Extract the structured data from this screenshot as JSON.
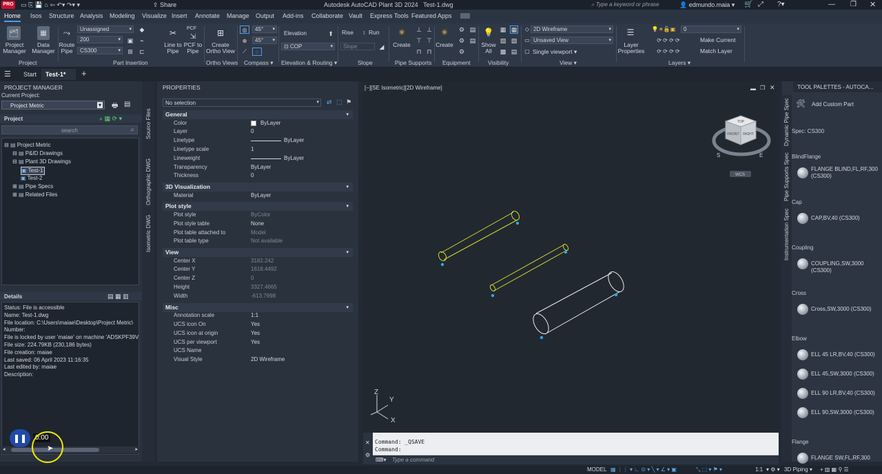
{
  "titlebar": {
    "app_badge": "PRO",
    "share": "Share",
    "title": "Autodesk AutoCAD Plant 3D 2024",
    "filename": "Test-1.dwg",
    "search_placeholder": "Type a keyword or phrase",
    "user": "edmundo.maia"
  },
  "menu": [
    "Home",
    "Isos",
    "Structure",
    "Analysis",
    "Modeling",
    "Visualize",
    "Insert",
    "Annotate",
    "Manage",
    "Output",
    "Add-ins",
    "Collaborate",
    "Vault",
    "Express Tools",
    "Featured Apps"
  ],
  "ribbon": {
    "project_manager": "Project\nManager",
    "data_manager": "Data\nManager",
    "route_pipe": "Route\nPipe",
    "unassigned": "Unassigned",
    "size": "200",
    "spec": "CS300",
    "line_to_pipe": "Line to\nPipe",
    "pcf_to_pipe": "PCF to\nPipe",
    "pcf": "PCF",
    "create_ortho": "Create\nOrtho View",
    "angle1": "45°",
    "angle2": "45°",
    "elevation": "Elevation",
    "cop": "COP",
    "rise": "Rise",
    "run": "Run",
    "slope": "Slope",
    "create_supports": "Create",
    "create_equipment": "Create",
    "show_all": "Show\nAll",
    "visual_style": "2D Wireframe",
    "saved_view": "Unsaved View",
    "viewport": "Single viewport",
    "layer_properties": "Layer\nProperties",
    "layer_value": "0",
    "make_current": "Make Current",
    "match_layer": "Match Layer",
    "groups": {
      "project": "Project",
      "part_insertion": "Part Insertion",
      "ortho_views": "Ortho Views",
      "compass": "Compass",
      "elevation_routing": "Elevation & Routing",
      "slope": "Slope",
      "pipe_supports": "Pipe Supports",
      "equipment": "Equipment",
      "visibility": "Visibility",
      "view": "View",
      "layers": "Layers"
    }
  },
  "doctabs": {
    "start": "Start",
    "active": "Test-1*"
  },
  "project_manager": {
    "title": "PROJECT MANAGER",
    "current_project_label": "Current Project:",
    "current_project": "Project Metric",
    "project_label": "Project",
    "search_placeholder": "search",
    "tree": [
      {
        "label": "Project Metric",
        "level": 0
      },
      {
        "label": "P&ID Drawings",
        "level": 1
      },
      {
        "label": "Plant 3D Drawings",
        "level": 1
      },
      {
        "label": "Test-1",
        "level": 2
      },
      {
        "label": "Test-2",
        "level": 2
      },
      {
        "label": "Pipe Specs",
        "level": 1
      },
      {
        "label": "Related Files",
        "level": 1
      }
    ],
    "details_title": "Details",
    "details": [
      "Status: File is accessible",
      "Name: Test-1.dwg",
      "File location: C:\\Users\\maiae\\Desktop\\Project Metric\\",
      "Number:",
      "File is locked by user 'maiae' on machine 'ADSKPF39V",
      "File size: 224.79KB (230,186 bytes)",
      "File creation: maiae",
      "Last saved: 06 April 2023 11:16:35",
      "Last edited by: maiae",
      "Description:"
    ],
    "side_tabs": [
      "Source Files",
      "Orthographic DWG",
      "Isometric DWG"
    ],
    "timer": "0:00"
  },
  "properties": {
    "title": "PROPERTIES",
    "selection": "No selection",
    "sections": [
      {
        "name": "General",
        "rows": [
          {
            "k": "Color",
            "v": "ByLayer"
          },
          {
            "k": "Layer",
            "v": "0"
          },
          {
            "k": "Linetype",
            "v": "ByLayer"
          },
          {
            "k": "Linetype scale",
            "v": "1"
          },
          {
            "k": "Lineweight",
            "v": "ByLayer"
          },
          {
            "k": "Transparency",
            "v": "ByLayer"
          },
          {
            "k": "Thickness",
            "v": "0"
          }
        ]
      },
      {
        "name": "3D Visualization",
        "rows": [
          {
            "k": "Material",
            "v": "ByLayer"
          }
        ]
      },
      {
        "name": "Plot style",
        "rows": [
          {
            "k": "Plot style",
            "v": "ByColor"
          },
          {
            "k": "Plot style table",
            "v": "None"
          },
          {
            "k": "Plot table attached to",
            "v": "Model"
          },
          {
            "k": "Plot table type",
            "v": "Not available"
          }
        ]
      },
      {
        "name": "View",
        "rows": [
          {
            "k": "Center X",
            "v": "3182.242"
          },
          {
            "k": "Center Y",
            "v": "1618.4492"
          },
          {
            "k": "Center Z",
            "v": "0"
          },
          {
            "k": "Height",
            "v": "3327.4665"
          },
          {
            "k": "Width",
            "v": "-613.7998"
          }
        ]
      },
      {
        "name": "Misc",
        "rows": [
          {
            "k": "Annotation scale",
            "v": "1:1"
          },
          {
            "k": "UCS icon On",
            "v": "Yes"
          },
          {
            "k": "UCS icon at origin",
            "v": "Yes"
          },
          {
            "k": "UCS per viewport",
            "v": "Yes"
          },
          {
            "k": "UCS Name",
            "v": ""
          },
          {
            "k": "Visual Style",
            "v": "2D Wireframe"
          }
        ]
      }
    ]
  },
  "viewport": {
    "label": "[−][SE Isometric][2D Wireframe]",
    "viewcube": {
      "top": "TOP",
      "front": "FRONT",
      "right": "RIGHT",
      "s": "S",
      "e": "E",
      "ucs": "WCS"
    },
    "axes": {
      "z": "Z",
      "y": "Y",
      "x": "X"
    }
  },
  "command": {
    "line1": "Command: _QSAVE",
    "line2": "Command:",
    "placeholder": "Type a command"
  },
  "tool_palettes": {
    "title": "TOOL PALETTES - AUTOCA...",
    "add_custom": "Add Custom Part",
    "spec": "Spec: CS300",
    "side_tabs": [
      "Dynamic Pipe Spec",
      "Pipe Supports Spec",
      "Instrumentation Spec"
    ],
    "categories": [
      {
        "name": "BlindFlange",
        "items": [
          "FLANGE BLIND,FL,RF,300 (CS300)"
        ]
      },
      {
        "name": "Cap",
        "items": [
          "CAP,BV,40 (CS300)"
        ]
      },
      {
        "name": "Coupling",
        "items": [
          "COUPLING,SW,3000 (CS300)"
        ]
      },
      {
        "name": "Cross",
        "items": [
          "Cross,SW,3000 (CS300)"
        ]
      },
      {
        "name": "Elbow",
        "items": [
          "ELL 45 LR,BV,40 (CS300)",
          "ELL 45,SW,3000 (CS300)",
          "ELL 90 LR,BV,40 (CS300)",
          "ELL 90,SW,3000 (CS300)"
        ]
      },
      {
        "name": "Flange",
        "items": [
          "FLANGE SW,FL,RF,300"
        ]
      }
    ]
  },
  "status": {
    "model": "MODEL",
    "scale": "1:1",
    "workspace": "3D Piping"
  },
  "colors": {
    "selected_pipe": "#d8d82a",
    "pipe": "#e8eaee",
    "grip": "#2ba7e6",
    "accent": "#4b9ff2"
  }
}
